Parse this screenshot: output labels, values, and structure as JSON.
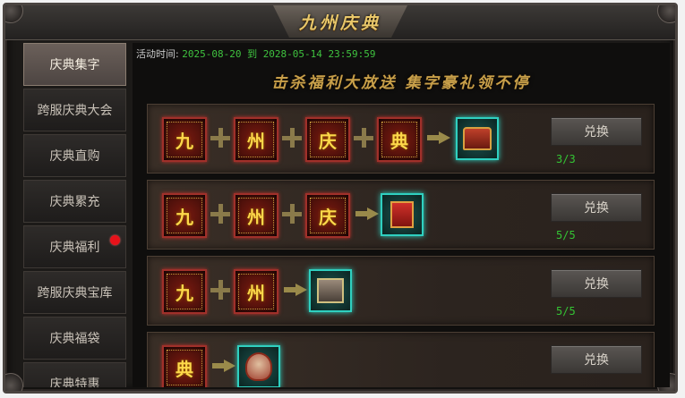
{
  "window": {
    "title": "九州庆典"
  },
  "sidebar": {
    "tabs": [
      {
        "label": "庆典集字",
        "active": true,
        "badge": false
      },
      {
        "label": "跨服庆典大会",
        "active": false,
        "badge": false
      },
      {
        "label": "庆典直购",
        "active": false,
        "badge": false
      },
      {
        "label": "庆典累充",
        "active": false,
        "badge": false
      },
      {
        "label": "庆典福利",
        "active": false,
        "badge": true
      },
      {
        "label": "跨服庆典宝库",
        "active": false,
        "badge": false
      },
      {
        "label": "庆典福袋",
        "active": false,
        "badge": false
      },
      {
        "label": "庆典特惠",
        "active": false,
        "badge": false
      }
    ]
  },
  "activity": {
    "time_label": "活动时间:",
    "time_range": "2025-08-20 到 2028-05-14 23:59:59",
    "slogan": "击杀福利大放送 集字豪礼领不停"
  },
  "rows": [
    {
      "chars": [
        "九",
        "州",
        "庆",
        "典"
      ],
      "reward_icon": "treasure-chest-icon",
      "button": "兑换",
      "count": "3/3"
    },
    {
      "chars": [
        "九",
        "州",
        "庆"
      ],
      "reward_icon": "red-book-icon",
      "button": "兑换",
      "count": "5/5"
    },
    {
      "chars": [
        "九",
        "州"
      ],
      "reward_icon": "gift-box-icon",
      "button": "兑换",
      "count": "5/5"
    },
    {
      "chars": [
        "典"
      ],
      "reward_icon": "warrior-portrait-icon",
      "button": "兑换",
      "count": ""
    }
  ],
  "colors": {
    "accent_gold": "#e8c76a",
    "count_green": "#34c434",
    "badge_red": "#e8121a",
    "reward_glow": "#2fd0c0"
  }
}
